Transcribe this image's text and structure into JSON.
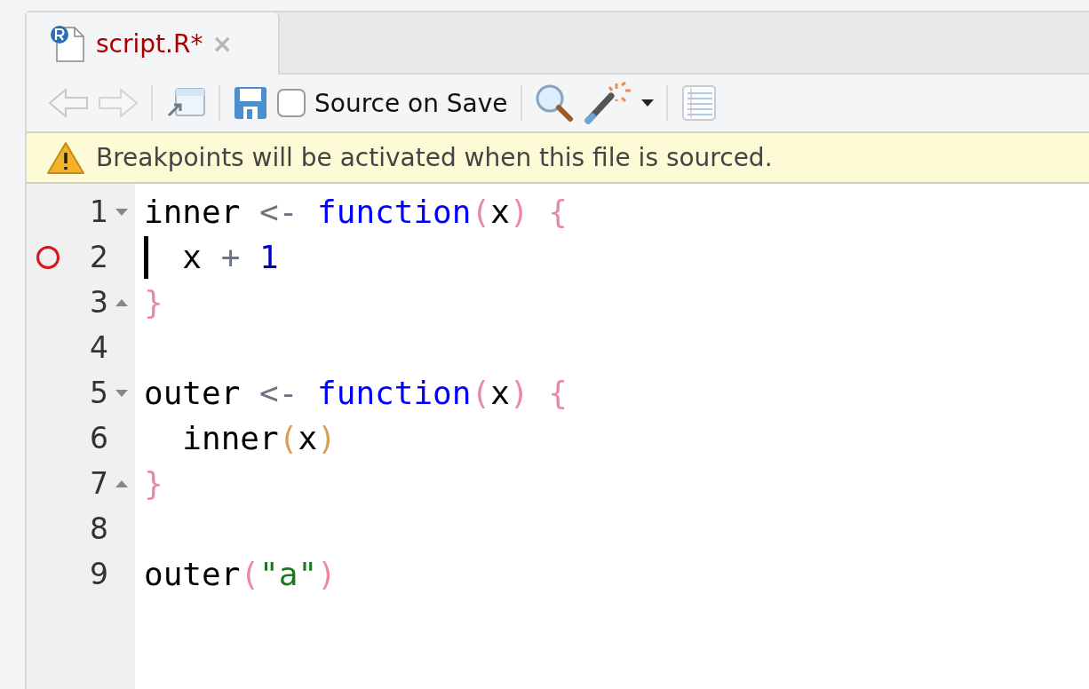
{
  "tabs": [
    {
      "label": "script.R*",
      "selected": true,
      "close": "×"
    }
  ],
  "toolbar": {
    "source_on_save": {
      "label": "Source on Save",
      "checked": false
    }
  },
  "warning": {
    "text": "Breakpoints will be activated when this file is sourced."
  },
  "lines": [
    {
      "number": "1",
      "fold_start": true,
      "fold_end": false,
      "breakpoint": false,
      "cursor": false,
      "tokens": [
        {
          "kind": "ident",
          "text": "inner"
        },
        {
          "kind": "op",
          "text": " <- "
        },
        {
          "kind": "keyword",
          "text": "function"
        },
        {
          "kind": "paren",
          "text": "("
        },
        {
          "kind": "ident",
          "text": "x"
        },
        {
          "kind": "paren",
          "text": ") {"
        }
      ]
    },
    {
      "number": "2",
      "fold_start": false,
      "fold_end": false,
      "breakpoint": true,
      "cursor": true,
      "tokens": [
        {
          "kind": "ident",
          "text": "  x"
        },
        {
          "kind": "op",
          "text": " + "
        },
        {
          "kind": "number",
          "text": "1"
        }
      ]
    },
    {
      "number": "3",
      "fold_start": false,
      "fold_end": true,
      "breakpoint": false,
      "cursor": false,
      "tokens": [
        {
          "kind": "paren",
          "text": "}"
        }
      ]
    },
    {
      "number": "4",
      "fold_start": false,
      "fold_end": false,
      "breakpoint": false,
      "cursor": false
    },
    {
      "number": "5",
      "fold_start": true,
      "fold_end": false,
      "breakpoint": false,
      "cursor": false,
      "tokens": [
        {
          "kind": "ident",
          "text": "outer"
        },
        {
          "kind": "op",
          "text": " <- "
        },
        {
          "kind": "keyword",
          "text": "function"
        },
        {
          "kind": "paren",
          "text": "("
        },
        {
          "kind": "ident",
          "text": "x"
        },
        {
          "kind": "paren",
          "text": ") {"
        }
      ]
    },
    {
      "number": "6",
      "fold_start": false,
      "fold_end": false,
      "breakpoint": false,
      "cursor": false,
      "tokens": [
        {
          "kind": "ident",
          "text": "  inner"
        },
        {
          "kind": "paren2",
          "text": "("
        },
        {
          "kind": "ident",
          "text": "x"
        },
        {
          "kind": "paren2",
          "text": ")"
        }
      ]
    },
    {
      "number": "7",
      "fold_start": false,
      "fold_end": true,
      "breakpoint": false,
      "cursor": false,
      "tokens": [
        {
          "kind": "paren",
          "text": "}"
        }
      ]
    },
    {
      "number": "8",
      "fold_start": false,
      "fold_end": false,
      "breakpoint": false,
      "cursor": false
    },
    {
      "number": "9",
      "fold_start": false,
      "fold_end": false,
      "breakpoint": false,
      "cursor": false,
      "tokens": [
        {
          "kind": "ident",
          "text": "outer"
        },
        {
          "kind": "paren",
          "text": "("
        },
        {
          "kind": "string",
          "text": "\"a\""
        },
        {
          "kind": "paren",
          "text": ")"
        }
      ]
    }
  ]
}
